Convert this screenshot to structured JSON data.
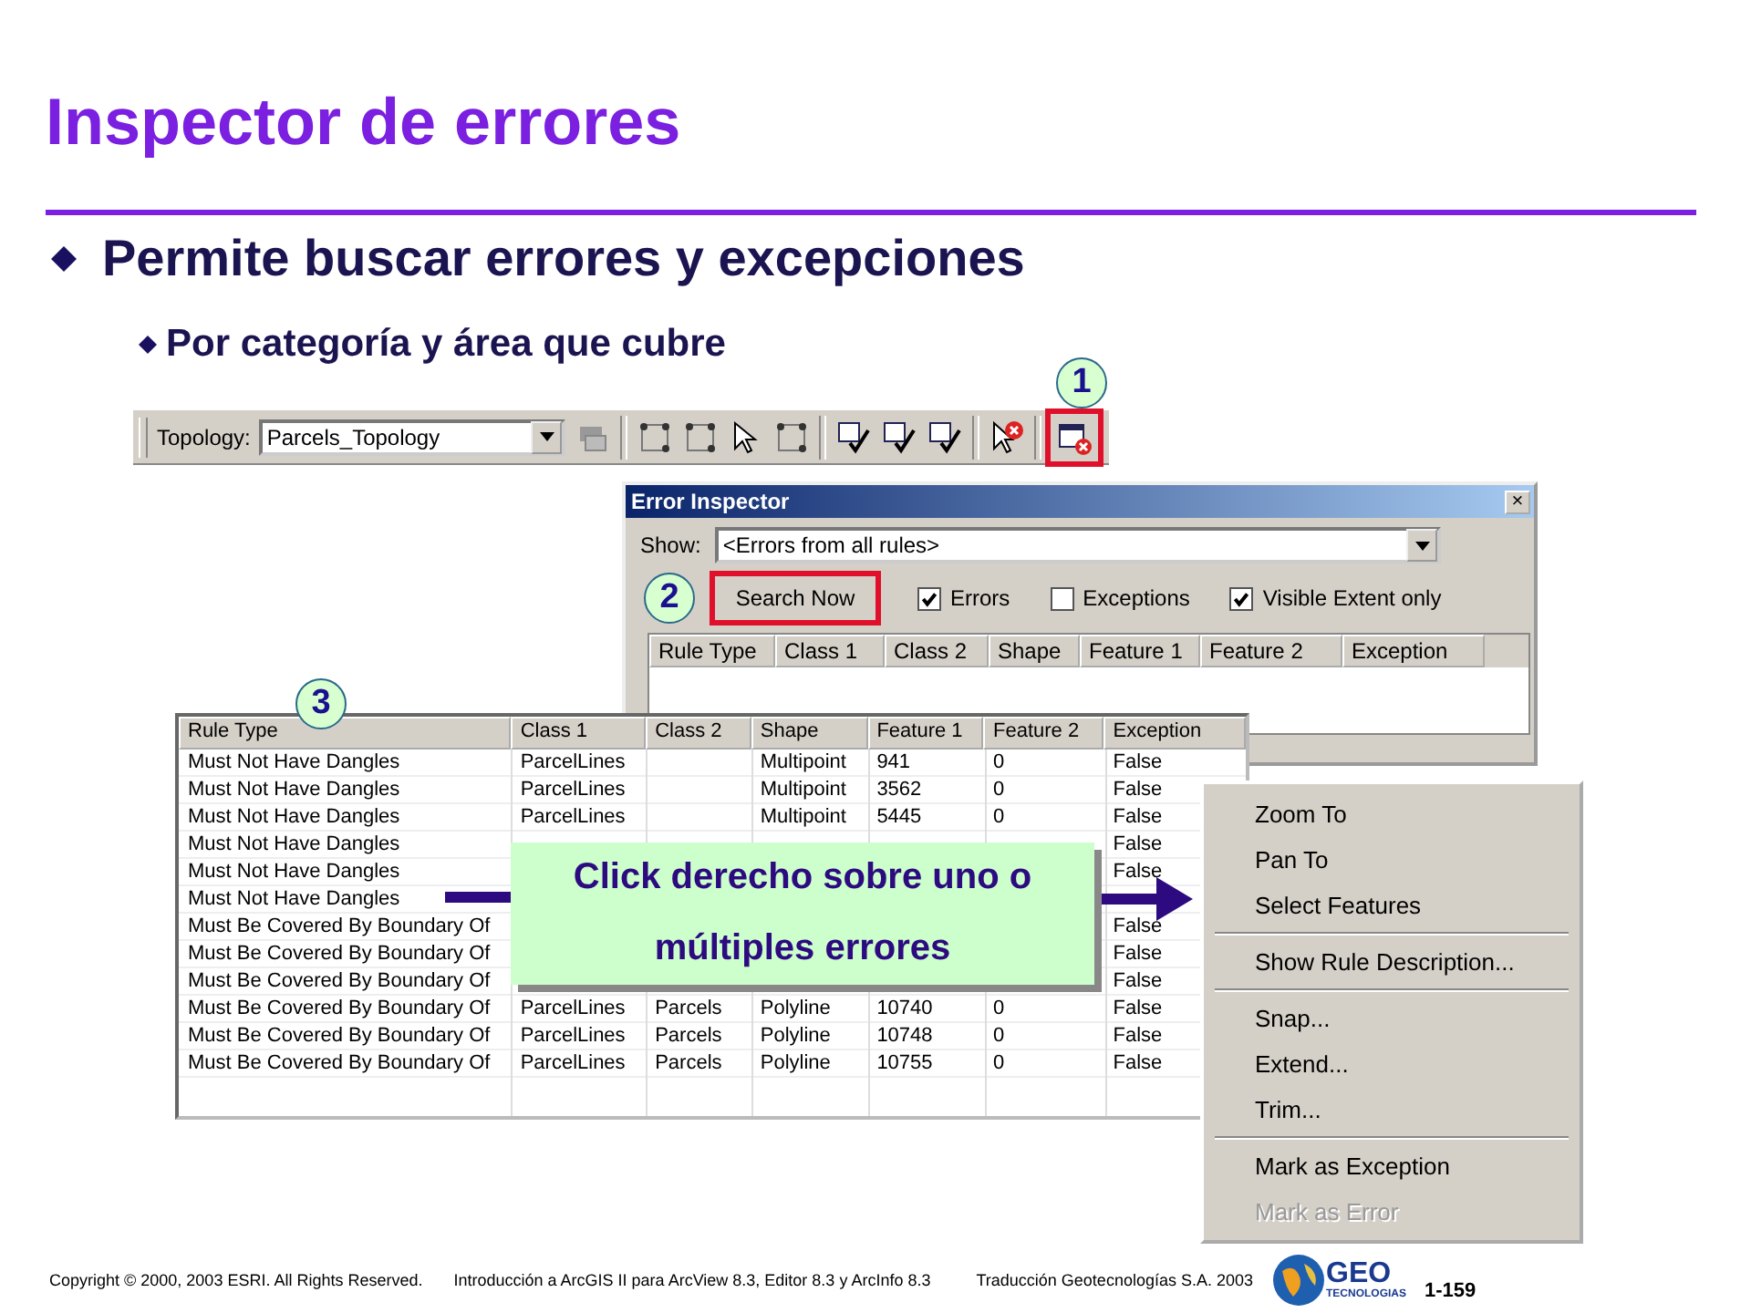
{
  "title": "Inspector de errores",
  "bullets": [
    {
      "text": "Permite buscar errores y excepciones",
      "children": [
        {
          "text": "Por categoría y área que cubre"
        }
      ]
    }
  ],
  "steps": [
    "1",
    "2",
    "3"
  ],
  "toolbar": {
    "label": "Topology:",
    "dropdown": "Parcels_Topology"
  },
  "dialog": {
    "title": "Error Inspector",
    "close": "×",
    "show_label": "Show:",
    "show_value": "<Errors from all rules>",
    "search_button": "Search Now",
    "checkboxes": [
      {
        "label": "Errors",
        "checked": true
      },
      {
        "label": "Exceptions",
        "checked": false
      },
      {
        "label": "Visible Extent only",
        "checked": true
      }
    ],
    "columns": [
      "Rule Type",
      "Class 1",
      "Class 2",
      "Shape",
      "Feature 1",
      "Feature 2",
      "Exception"
    ]
  },
  "table": {
    "columns": [
      "Rule Type",
      "Class 1",
      "Class 2",
      "Shape",
      "Feature 1",
      "Feature 2",
      "Exception"
    ],
    "rows": [
      {
        "cells": [
          "Must Not Have Dangles",
          "ParcelLines",
          null,
          "Multipoint",
          "941",
          "0",
          "False"
        ]
      },
      {
        "cells": [
          "Must Not Have Dangles",
          "ParcelLines",
          null,
          "Multipoint",
          "3562",
          "0",
          "False"
        ]
      },
      {
        "cells": [
          "Must Not Have Dangles",
          "ParcelLines",
          null,
          "Multipoint",
          "5445",
          "0",
          "False"
        ]
      },
      {
        "cells": [
          "Must Not Have Dangles",
          null,
          null,
          null,
          null,
          null,
          "False"
        ]
      },
      {
        "cells": [
          "Must Not Have Dangles",
          null,
          null,
          null,
          null,
          null,
          "False"
        ]
      },
      {
        "cells": [
          "Must Not Have Dangles",
          null,
          null,
          null,
          null,
          null,
          null
        ]
      },
      {
        "cells": [
          "Must Be Covered By Boundary Of",
          null,
          null,
          null,
          null,
          null,
          "False"
        ]
      },
      {
        "cells": [
          "Must Be Covered By Boundary Of",
          null,
          null,
          null,
          null,
          null,
          "False"
        ]
      },
      {
        "cells": [
          "Must Be Covered By Boundary Of",
          null,
          null,
          null,
          null,
          null,
          "False"
        ]
      },
      {
        "cells": [
          "Must Be Covered By Boundary Of",
          "ParcelLines",
          "Parcels",
          "Polyline",
          "10740",
          "0",
          "False"
        ]
      },
      {
        "cells": [
          "Must Be Covered By Boundary Of",
          "ParcelLines",
          "Parcels",
          "Polyline",
          "10748",
          "0",
          "False"
        ]
      },
      {
        "cells": [
          "Must Be Covered By Boundary Of",
          "ParcelLines",
          "Parcels",
          "Polyline",
          "10755",
          "0",
          "False"
        ]
      }
    ]
  },
  "callout": [
    "Click derecho sobre uno o",
    "múltiples errores"
  ],
  "context_menu": [
    {
      "kind": "item",
      "label": "Zoom To",
      "disabled": false
    },
    {
      "kind": "item",
      "label": "Pan To",
      "disabled": false
    },
    {
      "kind": "item",
      "label": "Select Features",
      "disabled": false
    },
    {
      "kind": "separator"
    },
    {
      "kind": "item",
      "label": "Show Rule Description...",
      "disabled": false
    },
    {
      "kind": "separator"
    },
    {
      "kind": "item",
      "label": "Snap...",
      "disabled": false
    },
    {
      "kind": "item",
      "label": "Extend...",
      "disabled": false
    },
    {
      "kind": "item",
      "label": "Trim...",
      "disabled": false
    },
    {
      "kind": "separator"
    },
    {
      "kind": "item",
      "label": "Mark as Exception",
      "disabled": false
    },
    {
      "kind": "item",
      "label": "Mark as Error",
      "disabled": true
    }
  ],
  "footer": {
    "copyright": "Copyright © 2000, 2003 ESRI.  All Rights Reserved.",
    "course": "Introducción a ArcGIS II para ArcView 8.3, Editor 8.3 y ArcInfo 8.3",
    "translation": "Traducción Geotecnologías S.A.  2003",
    "logo_text": "GEO",
    "logo_sub": "TECNOLOGIAS",
    "page": "1-159"
  }
}
